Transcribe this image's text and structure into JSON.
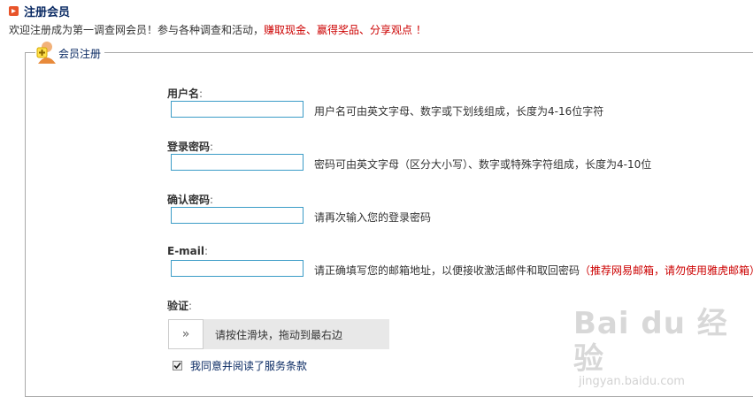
{
  "header": {
    "title": "注册会员",
    "welcome_prefix": "欢迎注册成为第一调查网会员！参与各种调查和活动，",
    "welcome_highlight": "赚取现金、赢得奖品、分享观点 ！"
  },
  "form": {
    "legend": "会员注册",
    "colon": ":",
    "fields": [
      {
        "label": "用户名",
        "value": "",
        "hint": "用户名可由英文字母、数字或下划线组成，长度为4-16位字符"
      },
      {
        "label": "登录密码",
        "value": "",
        "hint": "密码可由英文字母（区分大小写）、数字或特殊字符组成，长度为4-10位"
      },
      {
        "label": "确认密码",
        "value": "",
        "hint": "请再次输入您的登录密码"
      },
      {
        "label": "E-mail",
        "value": "",
        "hint": "请正确填写您的邮箱地址，以便接收激活邮件和取回密码",
        "hint_red": "（推荐网易邮箱，请勿使用雅虎邮箱）"
      }
    ],
    "verify": {
      "label": "验证",
      "slider_handle": "»",
      "slider_text": "请按住滑块，拖动到最右边"
    },
    "agree": {
      "checked": true,
      "text": "我同意并阅读了服务条款"
    }
  },
  "watermark": {
    "main": "Bai du 经验",
    "sub": "jingyan.baidu.com"
  },
  "colors": {
    "title": "#0a2a63",
    "highlight": "#cc0000",
    "input_border": "#3b9cc7",
    "icon": "#e8542a"
  }
}
